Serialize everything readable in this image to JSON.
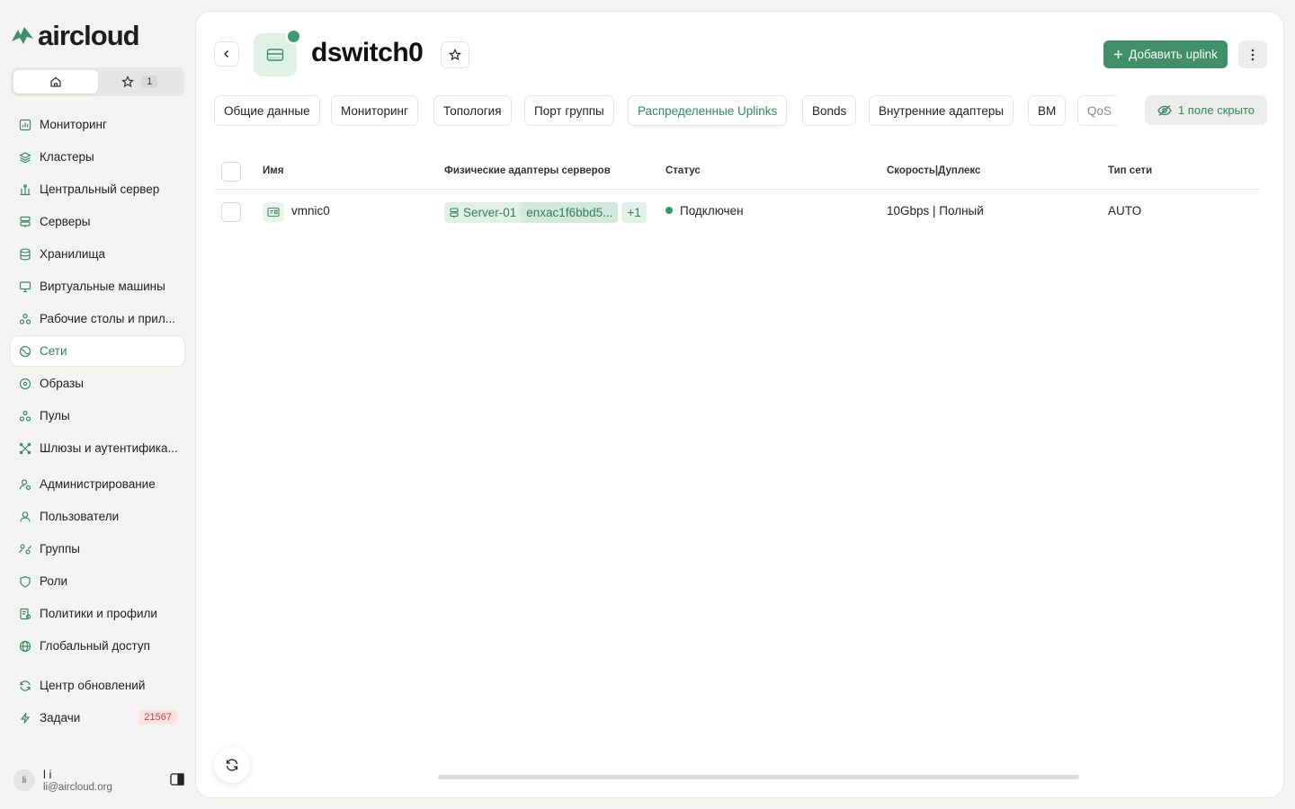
{
  "app": {
    "brand": "aircloud"
  },
  "switcher": {
    "favorites_count": "1"
  },
  "nav": {
    "items": [
      {
        "label": "Мониторинг",
        "icon": "chart-icon"
      },
      {
        "label": "Кластеры",
        "icon": "layers-icon"
      },
      {
        "label": "Центральный сервер",
        "icon": "hub-icon"
      },
      {
        "label": "Серверы",
        "icon": "server-icon"
      },
      {
        "label": "Хранилища",
        "icon": "database-icon"
      },
      {
        "label": "Виртуальные машины",
        "icon": "monitor-icon"
      },
      {
        "label": "Рабочие столы и прил...",
        "icon": "apps-icon"
      },
      {
        "label": "Сети",
        "icon": "network-icon"
      },
      {
        "label": "Образы",
        "icon": "disc-icon"
      },
      {
        "label": "Пулы",
        "icon": "pool-icon"
      },
      {
        "label": "Шлюзы и аутентифика...",
        "icon": "gateway-icon"
      },
      {
        "label": "Администрирование",
        "icon": "admin-icon"
      },
      {
        "label": "Пользователи",
        "icon": "user-icon"
      },
      {
        "label": "Группы",
        "icon": "group-icon"
      },
      {
        "label": "Роли",
        "icon": "shield-icon"
      },
      {
        "label": "Политики и профили",
        "icon": "policy-icon"
      },
      {
        "label": "Глобальный доступ",
        "icon": "globe-icon"
      },
      {
        "label": "Центр обновлений",
        "icon": "refresh-icon"
      },
      {
        "label": "Задачи",
        "icon": "bolt-icon",
        "badge": "21567"
      }
    ]
  },
  "user": {
    "initials": "li",
    "name": "l i",
    "email": "li@aircloud.org"
  },
  "header": {
    "title": "dswitch0",
    "add_button": "Добавить uplink"
  },
  "tabs": [
    "Общие данные",
    "Мониторинг",
    "Топология",
    "Порт группы",
    "Распределенные Uplinks",
    "Bonds",
    "Внутренние адаптеры",
    "ВМ",
    "QoS"
  ],
  "hidden_fields": "1 поле скрыто",
  "table": {
    "columns": [
      "Имя",
      "Физические адаптеры серверов",
      "Статус",
      "Скорость|Дуплекс",
      "Тип сети"
    ],
    "rows": [
      {
        "name": "vmnic0",
        "server": "Server-01",
        "mac": "enxac1f6bbd5...",
        "more": "+1",
        "status": "Подключен",
        "speed": "10Gbps | Полный",
        "net_type": "AUTO"
      }
    ]
  },
  "colors": {
    "accent": "#3f8f69",
    "accent_light": "#dff0e7",
    "badge": "#d23b3b"
  }
}
